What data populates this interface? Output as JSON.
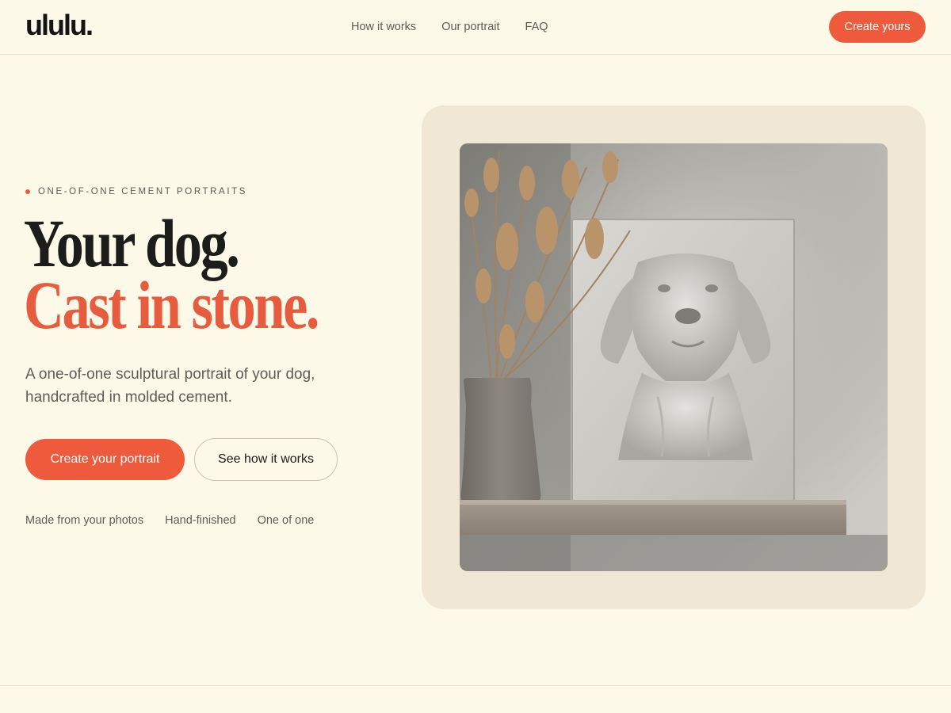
{
  "header": {
    "logo": "ululu.",
    "nav": [
      "How it works",
      "Our portrait",
      "FAQ"
    ],
    "cta": "Create yours"
  },
  "hero": {
    "eyebrow": "ONE-OF-ONE CEMENT PORTRAITS",
    "title_line1": "Your dog.",
    "title_line2": "Cast in stone.",
    "subtitle": "A one-of-one sculptural portrait of your dog, handcrafted in molded cement.",
    "primary_button": "Create your portrait",
    "secondary_button": "See how it works",
    "features": [
      "Made from your photos",
      "Hand-finished",
      "One of one"
    ]
  },
  "colors": {
    "background": "#fdf9e9",
    "accent": "#ee5a3c",
    "panel": "#f0e8d5",
    "text": "#1c1c1a"
  }
}
